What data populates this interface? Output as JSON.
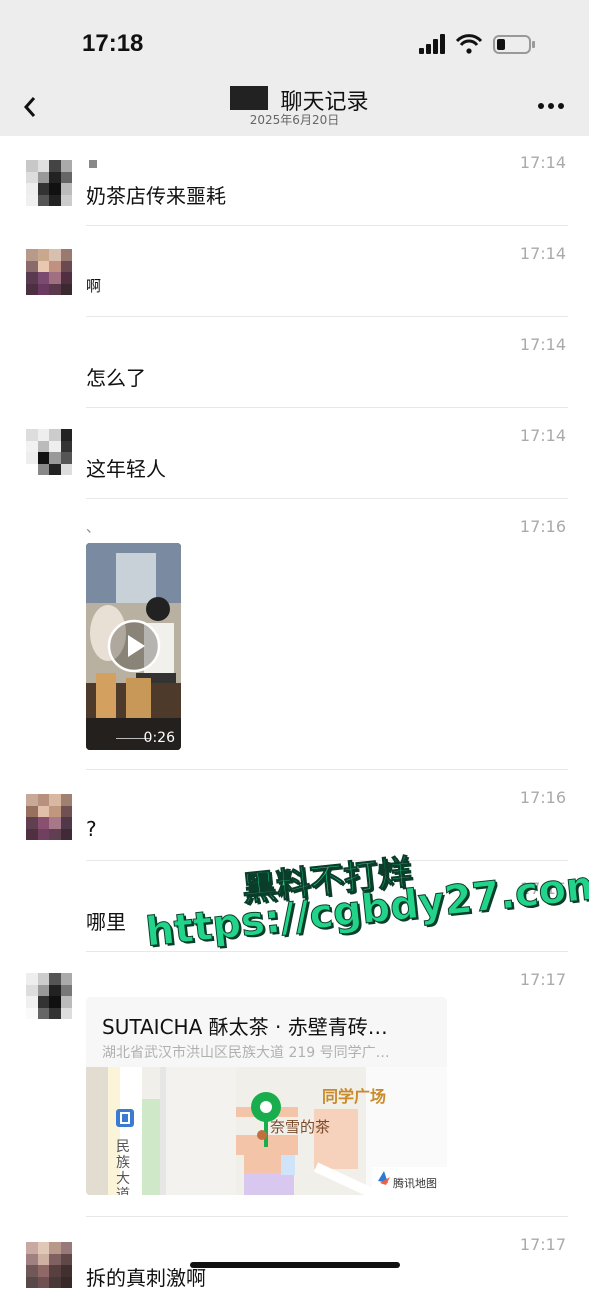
{
  "status_bar": {
    "time": "17:18"
  },
  "header": {
    "title": "聊天记录",
    "date": "2025年6月20日"
  },
  "messages": [
    {
      "name": "",
      "time": "17:14",
      "text": "奶茶店传来噩耗"
    },
    {
      "name": "",
      "time": "17:14",
      "text": "啊"
    },
    {
      "name": "",
      "time": "17:14",
      "text": "怎么了"
    },
    {
      "name": "",
      "time": "17:14",
      "text": "这年轻人"
    },
    {
      "name": "、",
      "time": "17:16",
      "video_duration": "0:26"
    },
    {
      "name": "",
      "time": "17:16",
      "text": "?"
    },
    {
      "name": "",
      "time": "17:16",
      "text": "哪里"
    },
    {
      "name": "",
      "time": "17:17",
      "location": {
        "title": "SUTAICHA 酥太茶 · 赤壁青砖…",
        "address": "湖北省武汉市洪山区民族大道 219 号同学广…",
        "map_labels": {
          "plaza": "同学广场",
          "shop": "奈雪的茶",
          "road": "民族大道",
          "provider": "腾讯地图"
        }
      }
    },
    {
      "name": "",
      "time": "17:17",
      "text": "拆的真刺激啊"
    }
  ],
  "watermark": {
    "line1": "黑料不打烊",
    "line2": "https://cgbdy27.com"
  },
  "colors": {
    "header_bg": "#ededed",
    "map_pin": "#1aad4e",
    "watermark_green": "#22d48a"
  }
}
